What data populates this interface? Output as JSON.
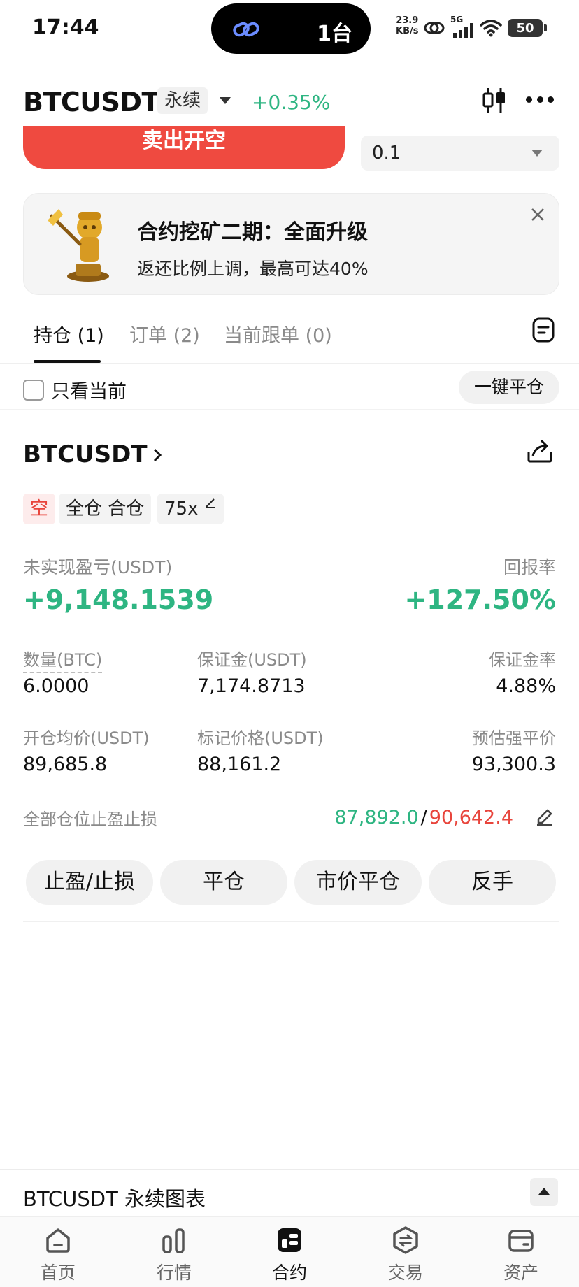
{
  "status_bar": {
    "time": "17:44",
    "island_text": "1台",
    "net_speed_value": "23.9",
    "net_speed_unit": "KB/s",
    "signal_label": "5G",
    "battery": "50"
  },
  "header": {
    "symbol": "BTCUSDT",
    "contract_type": "永续",
    "change_pct": "+0.35%"
  },
  "order": {
    "sell_label": "卖出开空",
    "quantity": "0.1"
  },
  "promo": {
    "title": "合约挖矿二期：全面升级",
    "subtitle": "返还比例上调，最高可达40%"
  },
  "tabs": [
    {
      "label": "持仓 (1)"
    },
    {
      "label": "订单 (2)"
    },
    {
      "label": "当前跟单 (0)"
    }
  ],
  "filter": {
    "only_current_label": "只看当前",
    "close_all_label": "一键平仓"
  },
  "position": {
    "symbol": "BTCUSDT",
    "side": "空",
    "margin_mode": "全仓 合仓",
    "leverage": "75x",
    "upnl_label": "未实现盈亏(USDT)",
    "upnl_value": "+9,148.1539",
    "roe_label": "回报率",
    "roe_value": "+127.50%",
    "qty_label": "数量(BTC)",
    "qty_value": "6.0000",
    "margin_label": "保证金(USDT)",
    "margin_value": "7,174.8713",
    "margin_ratio_label": "保证金率",
    "margin_ratio_value": "4.88%",
    "entry_label": "开仓均价(USDT)",
    "entry_value": "89,685.8",
    "mark_label": "标记价格(USDT)",
    "mark_value": "88,161.2",
    "liq_label": "预估强平价",
    "liq_value": "93,300.3",
    "tpsl_label": "全部仓位止盈止损",
    "tp_value": "87,892.0",
    "tpsl_separator": "/",
    "sl_value": "90,642.4"
  },
  "actions": {
    "tpsl": "止盈/止损",
    "close": "平仓",
    "market_close": "市价平仓",
    "reverse": "反手"
  },
  "chart_bar": {
    "title": "BTCUSDT 永续图表"
  },
  "bottom_nav": [
    {
      "label": "首页",
      "icon": "home-icon"
    },
    {
      "label": "行情",
      "icon": "market-icon"
    },
    {
      "label": "合约",
      "icon": "futures-icon"
    },
    {
      "label": "交易",
      "icon": "trade-icon"
    },
    {
      "label": "资产",
      "icon": "wallet-icon"
    }
  ],
  "colors": {
    "green": "#2eb582",
    "red": "#e8453c",
    "sell_button": "#ef4a40"
  }
}
